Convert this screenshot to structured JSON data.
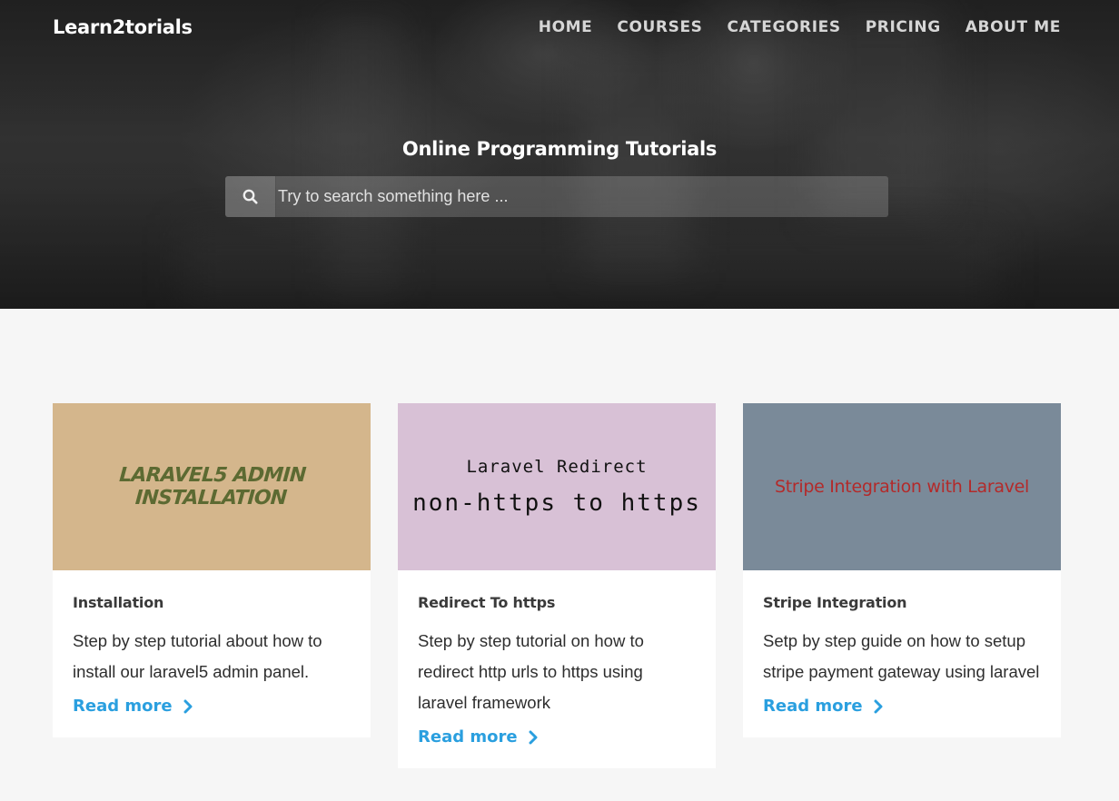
{
  "header": {
    "brand": "Learn2torials",
    "nav": [
      "HOME",
      "COURSES",
      "CATEGORIES",
      "PRICING",
      "ABOUT ME"
    ]
  },
  "hero": {
    "title": "Online Programming Tutorials",
    "search_placeholder": "Try to search something here ...",
    "search_icon": "search-icon"
  },
  "cards": [
    {
      "image_text": "LARAVEL5 ADMIN INSTALLATION",
      "title": "Installation",
      "description": "Step by step tutorial about how to install our laravel5 admin panel.",
      "link": "Read more",
      "image_bg": "#d4b68c"
    },
    {
      "image_text_1": "Laravel Redirect",
      "image_text_2": "non-https to https",
      "title": "Redirect To https",
      "description": "Step by step tutorial on how to redirect http urls to https using laravel framework",
      "link": "Read more",
      "image_bg": "#d8c1d6"
    },
    {
      "image_text": "Stripe Integration with Laravel",
      "title": "Stripe Integration",
      "description": "Setp by step guide on how to setup stripe payment gateway using laravel",
      "link": "Read more",
      "image_bg": "#7a8a99"
    }
  ],
  "colors": {
    "accent": "#2a9fdf",
    "page_bg": "#f6f6f6"
  }
}
